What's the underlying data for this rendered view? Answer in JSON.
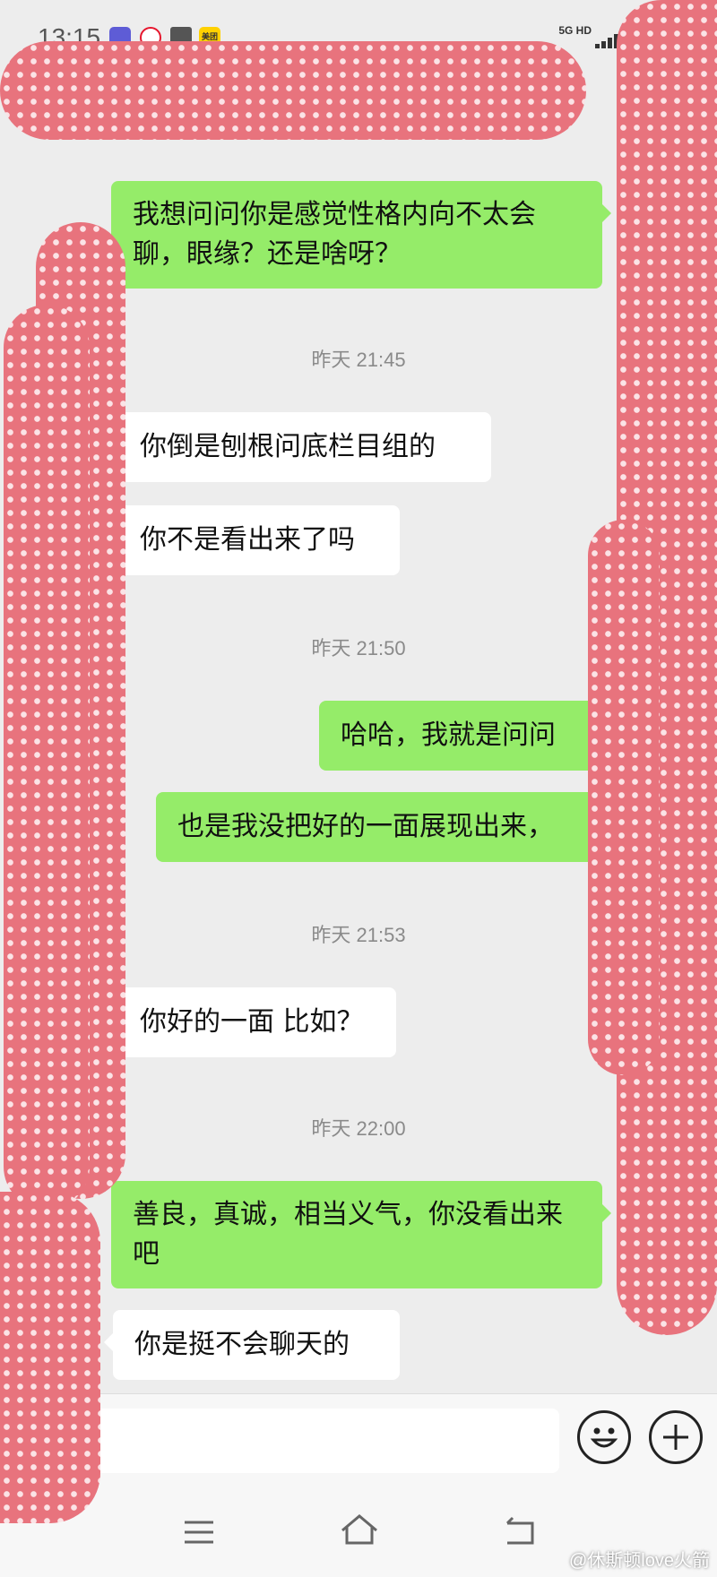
{
  "status_bar": {
    "time": "13:15",
    "network": "5G HD",
    "icons": [
      "notification-app-icon",
      "weibo-icon",
      "app-icon",
      "meituan-icon"
    ],
    "meituan_label": "美团"
  },
  "messages": [
    {
      "type": "sent",
      "text": "我想问问你是感觉性格内向不太会聊，眼缘？还是啥呀？"
    },
    {
      "type": "time",
      "text": "昨天 21:45"
    },
    {
      "type": "recv",
      "text": "你倒是刨根问底栏目组的"
    },
    {
      "type": "recv",
      "text": "你不是看出来了吗"
    },
    {
      "type": "time",
      "text": "昨天 21:50"
    },
    {
      "type": "sent",
      "text": "哈哈，我就是问问"
    },
    {
      "type": "sent",
      "text": "也是我没把好的一面展现出来，"
    },
    {
      "type": "time",
      "text": "昨天 21:53"
    },
    {
      "type": "recv",
      "text": "你好的一面 比如？"
    },
    {
      "type": "time",
      "text": "昨天 22:00"
    },
    {
      "type": "sent",
      "text": "善良，真诚，相当义气，你没看出来吧"
    },
    {
      "type": "recv",
      "text": "你是挺不会聊天的"
    }
  ],
  "input_bar": {
    "placeholder": "",
    "icons": [
      "emoji-icon",
      "plus-icon"
    ]
  },
  "nav_bar": {
    "icons": [
      "menu-icon",
      "home-icon",
      "back-icon"
    ]
  },
  "watermark": "@休斯顿love火箭",
  "colors": {
    "background": "#ededed",
    "sent_bubble": "#95ec69",
    "recv_bubble": "#ffffff",
    "redaction": "#e8737d"
  }
}
